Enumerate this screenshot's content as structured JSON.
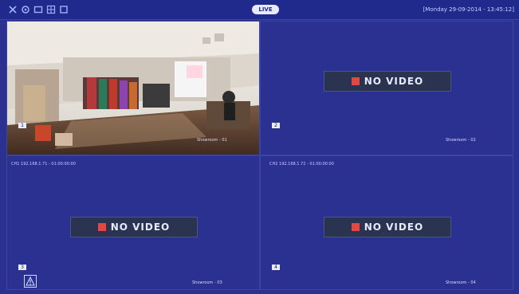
{
  "topbar": {
    "icons": [
      "close-icon",
      "settings-icon",
      "layout-icon",
      "grid-icon",
      "fullscreen-icon"
    ],
    "center_pill": "LIVE",
    "datetime": "[Monday 29-09-2014 - 13:45:12]"
  },
  "tiles": [
    {
      "id": "1",
      "name": "Showroom - 01",
      "status": "live"
    },
    {
      "id": "2",
      "name": "Showroom - 02",
      "status": "NO VIDEO"
    },
    {
      "id": "3",
      "name": "Showroom - 03",
      "status": "NO VIDEO"
    },
    {
      "id": "4",
      "name": "Showroom - 04",
      "status": "NO VIDEO"
    }
  ],
  "strip": {
    "left": "CH1 192.168.1.71 - 01:00:00:00",
    "right": "CH2 192.168.1.72 - 01:00:00:00"
  },
  "colors": {
    "background": "#2a3190",
    "topbar": "#1f2a8c",
    "no_video_panel": "#2a3451",
    "record_red": "#e3473d"
  }
}
